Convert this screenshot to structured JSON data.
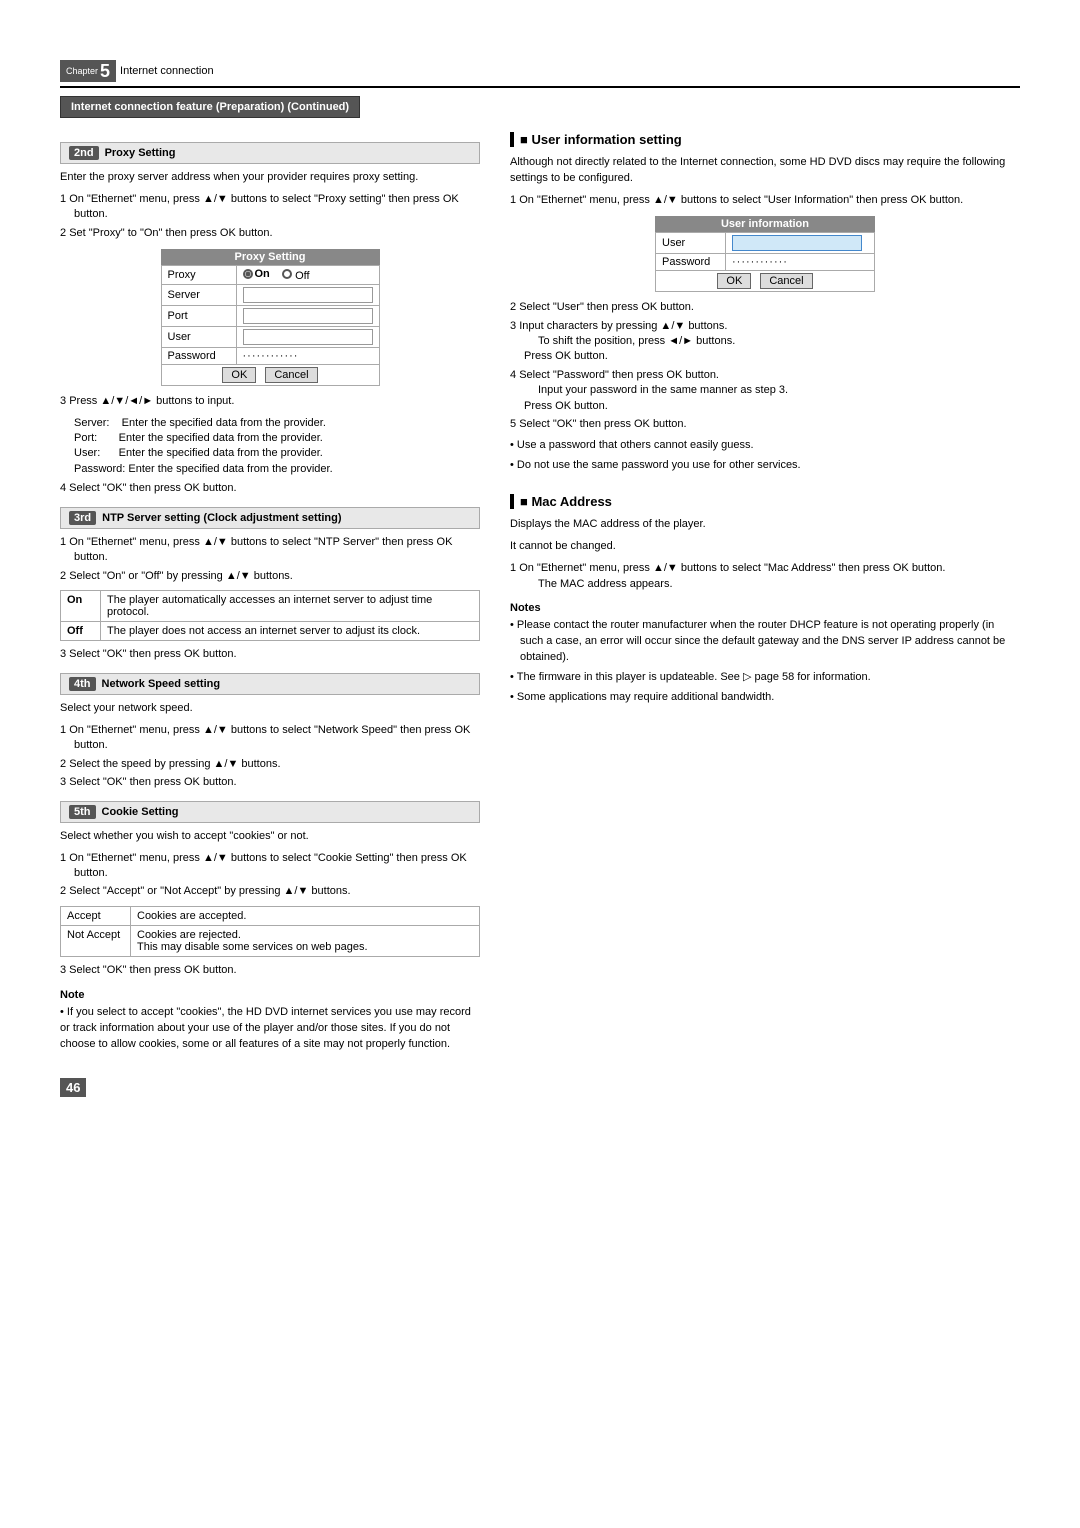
{
  "chapter": {
    "label": "Chapter",
    "number": "5",
    "title": "Internet connection"
  },
  "banner": "Internet connection feature (Preparation) (Continued)",
  "left_col": {
    "step2": {
      "badge": "2nd",
      "title": "Proxy Setting",
      "intro": "Enter the proxy server address when your provider requires proxy setting.",
      "instructions": [
        {
          "num": "1",
          "text": "On \"Ethernet\" menu, press ▲/▼ buttons to select \"Proxy setting\" then press OK button."
        },
        {
          "num": "2",
          "text": "Set \"Proxy\" to \"On\" then press OK button."
        }
      ],
      "table_caption": "Proxy Setting",
      "table_rows": [
        {
          "label": "Proxy",
          "value": "● On   ○ Off",
          "type": "radio"
        },
        {
          "label": "Server",
          "value": "",
          "type": "field"
        },
        {
          "label": "Port",
          "value": "",
          "type": "field"
        },
        {
          "label": "User",
          "value": "",
          "type": "field"
        },
        {
          "label": "Password",
          "value": "············",
          "type": "dots"
        }
      ],
      "ok_label": "OK",
      "cancel_label": "Cancel",
      "step3_instructions": [
        {
          "num": "3",
          "text": "Press ▲/▼/◄/► buttons to input."
        }
      ],
      "input_details": [
        {
          "label": "Server:",
          "text": "Enter the specified data from the provider."
        },
        {
          "label": "Port:",
          "text": "Enter the specified data from the provider."
        },
        {
          "label": "User:",
          "text": "Enter the specified data from the provider."
        },
        {
          "label": "Password:",
          "text": "Enter the specified data from the provider."
        }
      ],
      "step4_text": "4  Select \"OK\" then press OK button."
    },
    "step3": {
      "badge": "3rd",
      "title": "NTP Server setting (Clock adjustment setting)",
      "instructions": [
        {
          "num": "1",
          "text": "On \"Ethernet\" menu, press ▲/▼ buttons to select \"NTP Server\" then press OK button."
        },
        {
          "num": "2",
          "text": "Select \"On\" or \"Off\" by pressing ▲/▼ buttons."
        }
      ],
      "ntp_rows": [
        {
          "option": "On",
          "description": "The player automatically accesses an internet server to adjust time protocol."
        },
        {
          "option": "Off",
          "description": "The player does not access an internet server to adjust its clock."
        }
      ],
      "step3_text": "3  Select \"OK\" then press OK button."
    },
    "step4": {
      "badge": "4th",
      "title": "Network Speed setting",
      "intro": "Select your network speed.",
      "instructions": [
        {
          "num": "1",
          "text": "On \"Ethernet\" menu, press ▲/▼ buttons to select \"Network Speed\" then press OK button."
        },
        {
          "num": "2",
          "text": "Select the speed by pressing ▲/▼ buttons."
        },
        {
          "num": "3",
          "text": "Select \"OK\" then press OK button."
        }
      ]
    },
    "step5": {
      "badge": "5th",
      "title": "Cookie Setting",
      "intro": "Select whether you wish to accept \"cookies\" or not.",
      "instructions": [
        {
          "num": "1",
          "text": "On \"Ethernet\" menu, press ▲/▼ buttons to select \"Cookie Setting\" then press OK button."
        },
        {
          "num": "2",
          "text": "Select \"Accept\" or \"Not Accept\" by pressing ▲/▼ buttons."
        }
      ],
      "cookie_rows": [
        {
          "option": "Accept",
          "description": "Cookies are accepted."
        },
        {
          "option": "Not Accept",
          "description": "Cookies are rejected.\nThis may disable some services on web pages."
        }
      ],
      "step3_text": "3  Select \"OK\" then press OK button.",
      "note_heading": "Note",
      "note_text": "• If you select to accept \"cookies\", the HD DVD internet services you use may record or track information about your use of the player and/or those sites.  If you do not choose to allow cookies, some or all features of a site may not properly function."
    }
  },
  "right_col": {
    "user_info": {
      "section_title": "■ User information setting",
      "intro": "Although not directly related to the Internet connection, some HD DVD discs may require the following settings to be configured.",
      "instructions": [
        {
          "num": "1",
          "text": "On \"Ethernet\" menu, press ▲/▼ buttons to select \"User Information\" then press OK button."
        }
      ],
      "table_caption": "User information",
      "table_rows": [
        {
          "label": "User",
          "value": "",
          "type": "field-blue"
        },
        {
          "label": "Password",
          "value": "············",
          "type": "dots"
        }
      ],
      "ok_label": "OK",
      "cancel_label": "Cancel",
      "steps": [
        {
          "num": "2",
          "text": "Select \"User\" then press OK button."
        },
        {
          "num": "3",
          "text": "Input characters by pressing ▲/▼ buttons.\n      To shift the position, press ◄/► buttons.\n      Press OK button."
        },
        {
          "num": "4",
          "text": "Select \"Password\" then press OK button.\n      Input your password in the same manner as step 3.\n      Press OK button."
        },
        {
          "num": "5",
          "text": "Select \"OK\" then press OK button."
        }
      ],
      "bullets": [
        "Use a password that others cannot easily guess.",
        "Do not use the same password you use for other services."
      ]
    },
    "mac_address": {
      "section_title": "■ Mac Address",
      "intro1": "Displays the MAC address of the player.",
      "intro2": "It cannot be changed.",
      "instructions": [
        {
          "num": "1",
          "text": "On \"Ethernet\" menu, press ▲/▼ buttons to select \"Mac Address\" then press OK button.\n      The MAC address appears."
        }
      ]
    },
    "notes": {
      "heading": "Notes",
      "items": [
        "Please contact the router manufacturer when the router DHCP feature is not operating properly (in such a case, an error will occur since the default gateway and the DNS server IP address cannot be obtained).",
        "The firmware in this player is updateable. See ▷ page 58 for information.",
        "Some applications may require additional bandwidth."
      ]
    }
  },
  "page_number": "46"
}
